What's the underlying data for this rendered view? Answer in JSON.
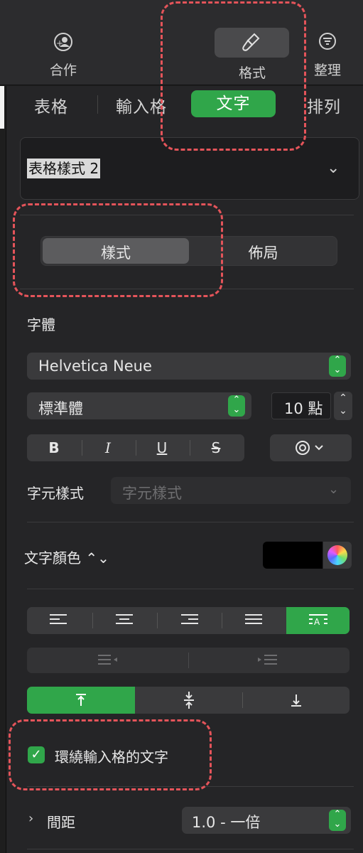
{
  "toolbar": {
    "collaborate_label": "合作",
    "format_label": "格式",
    "organize_label": "整理"
  },
  "tabs": {
    "table": "表格",
    "cell": "輸入格",
    "text": "文字",
    "arrange": "排列"
  },
  "table_style": {
    "name": "表格樣式 2"
  },
  "text_mode": {
    "style": "樣式",
    "layout": "佈局"
  },
  "font": {
    "section_label": "字體",
    "family": "Helvetica Neue",
    "typeface": "標準體",
    "size": "10 點"
  },
  "text_format_buttons": {
    "bold": "B",
    "italic": "I",
    "underline": "U",
    "strike": "S"
  },
  "char_style": {
    "label": "字元樣式",
    "placeholder": "字元樣式"
  },
  "text_color": {
    "label": "文字顏色 ⌃⌄",
    "color": "#000000"
  },
  "wrap": {
    "label": "環繞輸入格的文字",
    "checked": true
  },
  "spacing": {
    "label": "間距",
    "value": "1.0 - 一倍"
  },
  "colors": {
    "accent": "#30a64a",
    "annotation": "#e4545a"
  }
}
